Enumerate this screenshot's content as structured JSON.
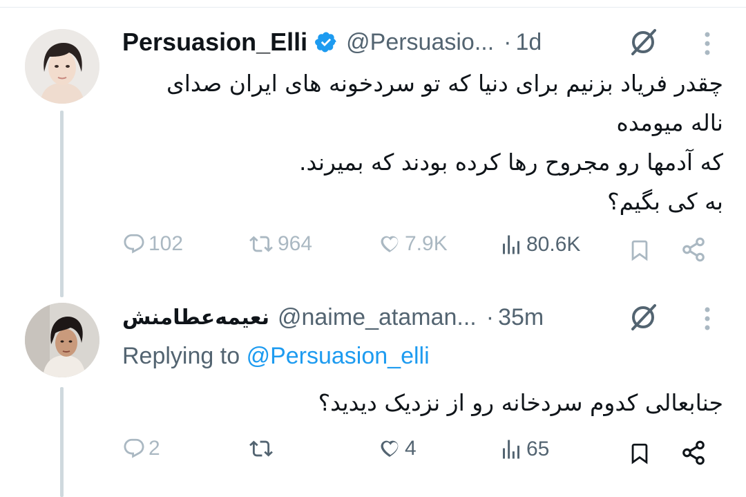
{
  "tweets": [
    {
      "display_name": "Persuasion_Elli",
      "verified": true,
      "handle": "@Persuasio...",
      "dot": "·",
      "time": "1d",
      "text_lines": [
        "چقدر فریاد بزنیم برای دنیا که تو سردخونه های ایران صدای",
        "ناله میومده",
        "که آدمها رو مجروح رها کرده بودند که بمیرند.",
        "به کی بگیم؟"
      ],
      "stats": {
        "replies": "102",
        "retweets": "964",
        "likes": "7.9K",
        "views": "80.6K"
      }
    },
    {
      "display_name": "نعیمه‌عطامنش",
      "verified": false,
      "handle": "@naime_ataman...",
      "dot": "·",
      "time": "35m",
      "replying_label": "Replying to",
      "replying_to": "@Persuasion_elli",
      "text_lines": [
        "جنابعالی کدوم سردخانه رو از نزدیک دیدید؟"
      ],
      "stats": {
        "replies": "2",
        "retweets": "",
        "likes": "4",
        "views": "65"
      }
    }
  ],
  "colors": {
    "text": "#0f1419",
    "secondary": "#536471",
    "accent": "#1d9bf0",
    "thread_line": "#cfd9de"
  },
  "icons": [
    "reply-icon",
    "retweet-icon",
    "like-icon",
    "views-icon",
    "bookmark-icon",
    "share-icon",
    "grok-icon",
    "more-icon",
    "verified-icon"
  ]
}
